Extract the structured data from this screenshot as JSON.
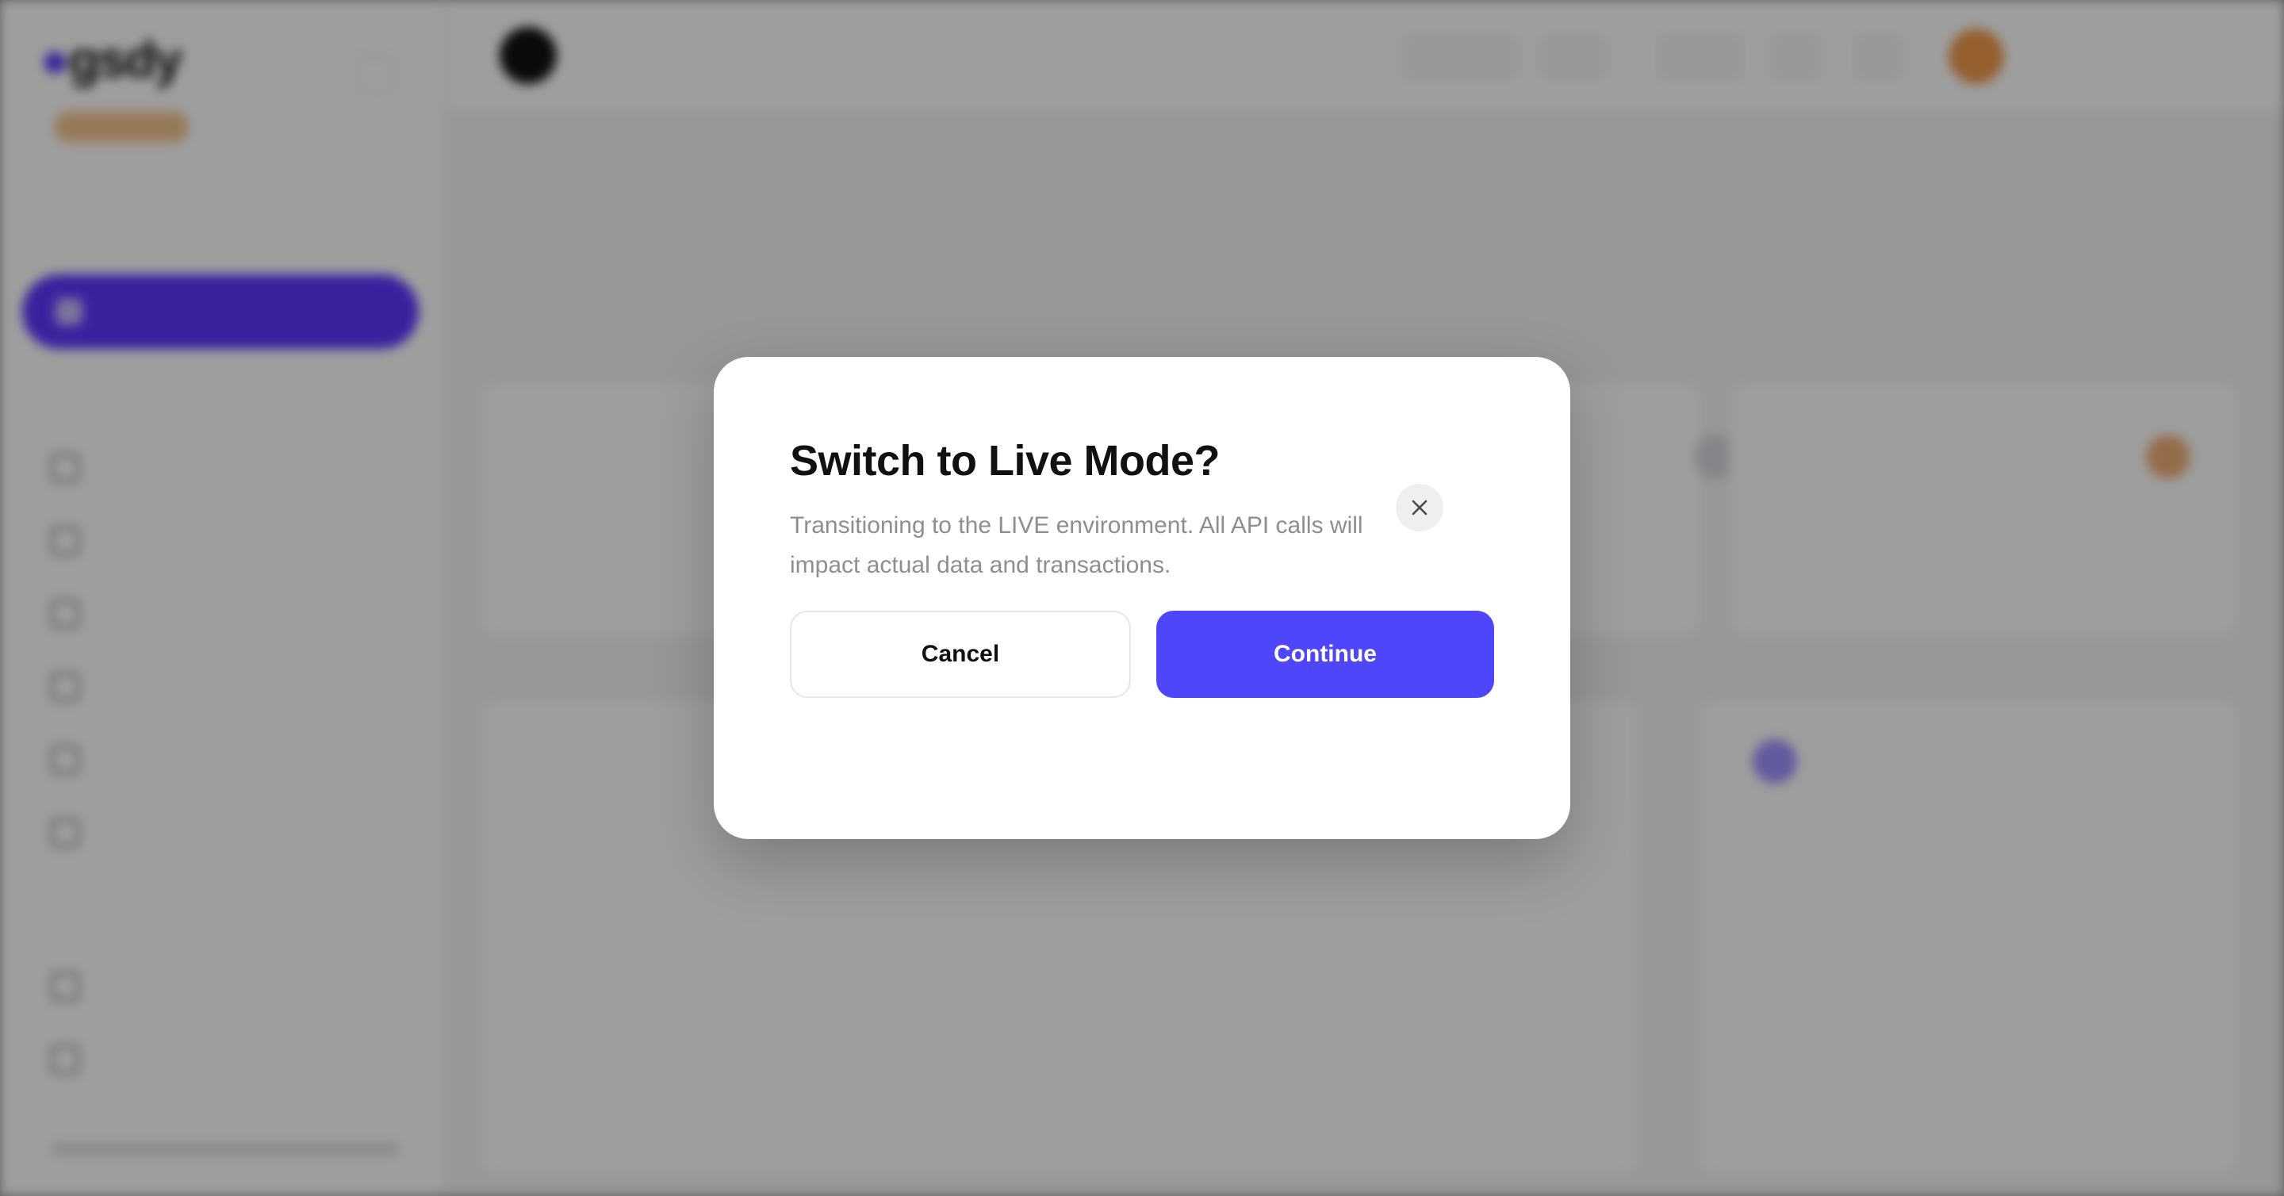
{
  "modal": {
    "title": "Switch to Live Mode?",
    "description": "Transitioning to the LIVE environment. All API calls will impact actual data and transactions.",
    "cancel_label": "Cancel",
    "continue_label": "Continue",
    "close_icon": "close-icon",
    "accent_color": "#4f46fb"
  }
}
